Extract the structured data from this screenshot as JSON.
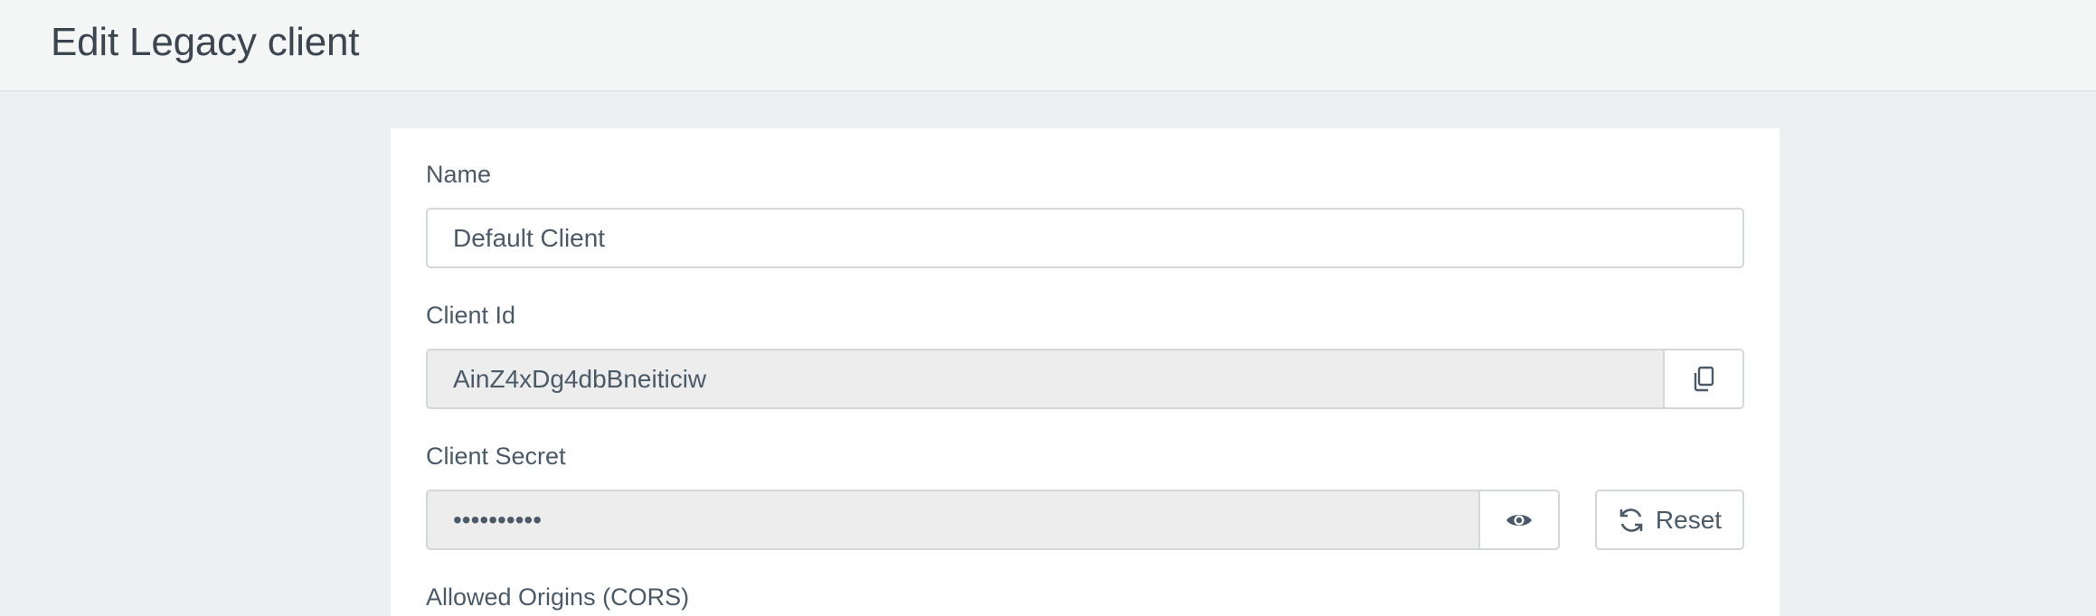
{
  "header": {
    "title": "Edit Legacy client"
  },
  "form": {
    "name": {
      "label": "Name",
      "value": "Default Client"
    },
    "client_id": {
      "label": "Client Id",
      "value": "AinZ4xDg4dbBneiticiw",
      "copy_icon": "copy-icon"
    },
    "client_secret": {
      "label": "Client Secret",
      "value": "••••••••••",
      "reveal_icon": "eye-icon",
      "reset_icon": "refresh-icon",
      "reset_label": "Reset"
    },
    "allowed_origins": {
      "label": "Allowed Origins (CORS)"
    }
  },
  "colors": {
    "header_bg": "#f4f6f6",
    "page_bg": "#ecf0f1",
    "panel_bg": "#ffffff",
    "readonly_bg": "#ededed",
    "text": "#4a5a68",
    "border": "#d3d7da"
  }
}
